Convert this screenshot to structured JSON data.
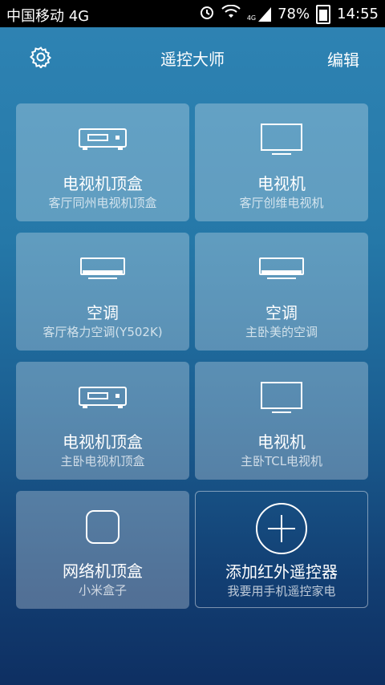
{
  "status": {
    "carrier": "中国移动 4G",
    "network": "4G",
    "battery": "78%",
    "time": "14:55"
  },
  "header": {
    "title": "遥控大师",
    "edit_label": "编辑"
  },
  "devices": [
    {
      "name": "电视机顶盒",
      "sub": "客厅同州电视机顶盒",
      "icon": "set-top-box-icon"
    },
    {
      "name": "电视机",
      "sub": "客厅创维电视机",
      "icon": "tv-icon"
    },
    {
      "name": "空调",
      "sub": "客厅格力空调(Y502K)",
      "icon": "air-conditioner-icon"
    },
    {
      "name": "空调",
      "sub": "主卧美的空调",
      "icon": "air-conditioner-icon"
    },
    {
      "name": "电视机顶盒",
      "sub": "主卧电视机顶盒",
      "icon": "set-top-box-icon"
    },
    {
      "name": "电视机",
      "sub": "主卧TCL电视机",
      "icon": "tv-icon"
    },
    {
      "name": "网络机顶盒",
      "sub": "小米盒子",
      "icon": "network-box-icon"
    }
  ],
  "add": {
    "name": "添加红外遥控器",
    "sub": "我要用手机遥控家电",
    "icon": "plus-circle-icon"
  }
}
